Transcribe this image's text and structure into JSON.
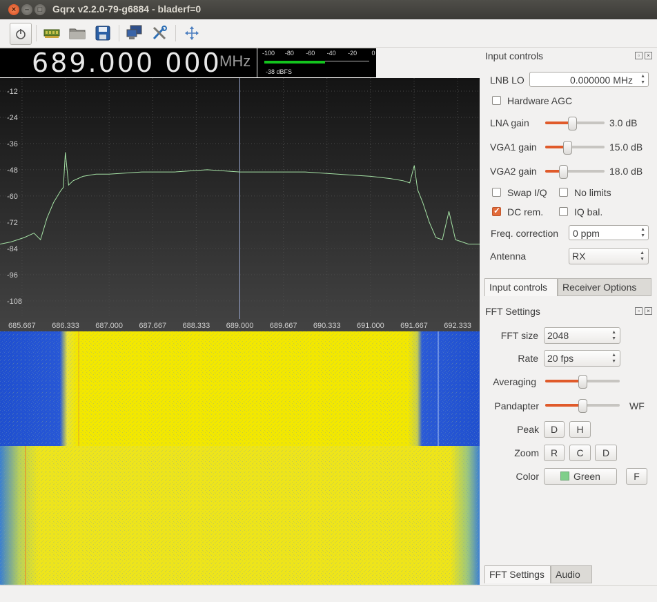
{
  "window": {
    "title": "Gqrx v2.2.0-79-g6884 - bladerf=0"
  },
  "toolbar": {
    "icons": [
      "power-icon",
      "hardware-icon",
      "folder-open-icon",
      "save-icon",
      "network-icon",
      "tools-icon",
      "fullscreen-icon"
    ]
  },
  "frequency": {
    "digits": "689.000 000",
    "unit": "MHz"
  },
  "meter": {
    "scale": [
      "-100",
      "-80",
      "-60",
      "-40",
      "-20",
      "0"
    ],
    "level_fraction": 0.58,
    "readout": "-38 dBFS"
  },
  "chart_data": {
    "type": "line",
    "title": "",
    "xlabel": "",
    "ylabel": "",
    "x_ticks": [
      "685.667",
      "686.333",
      "687.000",
      "687.667",
      "688.333",
      "689.000",
      "689.667",
      "690.333",
      "691.000",
      "691.667",
      "692.333"
    ],
    "y_ticks": [
      "-12",
      "-24",
      "-36",
      "-48",
      "-60",
      "-72",
      "-84",
      "-96",
      "-108"
    ],
    "xlim": [
      685.33,
      692.67
    ],
    "ylim": [
      -115,
      -6
    ],
    "center_marker": 689.0,
    "series": [
      {
        "color": "#a6e3a6",
        "x": [
          685.33,
          685.5,
          685.7,
          685.85,
          685.95,
          686.05,
          686.15,
          686.25,
          686.3,
          686.33,
          686.38,
          686.45,
          686.6,
          686.8,
          687.0,
          687.5,
          688.0,
          688.5,
          689.0,
          689.5,
          690.0,
          690.5,
          691.0,
          691.3,
          691.5,
          691.6,
          691.67,
          691.72,
          691.8,
          691.9,
          692.0,
          692.1,
          692.2,
          692.3,
          692.4,
          692.5,
          692.67
        ],
        "y": [
          -82,
          -81,
          -79,
          -77,
          -80,
          -70,
          -63,
          -58,
          -56,
          -40,
          -55,
          -53,
          -51,
          -50,
          -50,
          -49,
          -49,
          -48,
          -49,
          -49,
          -49,
          -50,
          -51,
          -52,
          -53,
          -54,
          -46,
          -57,
          -63,
          -72,
          -79,
          -80,
          -67,
          -80,
          -81,
          -82,
          -82
        ]
      }
    ]
  },
  "input_controls": {
    "header": "Input controls",
    "lnb_lo_label": "LNB LO",
    "lnb_lo_value": "0.000000 MHz",
    "hw_agc_label": "Hardware AGC",
    "hw_agc_checked": false,
    "lna_label": "LNA gain",
    "lna_value": "3.0 dB",
    "lna_level": 0.45,
    "vga1_label": "VGA1 gain",
    "vga1_value": "15.0 dB",
    "vga1_level": 0.37,
    "vga2_label": "VGA2 gain",
    "vga2_value": "18.0 dB",
    "vga2_level": 0.3,
    "swap_iq_label": "Swap I/Q",
    "swap_iq_checked": false,
    "no_limits_label": "No limits",
    "no_limits_checked": false,
    "dc_rem_label": "DC rem.",
    "dc_rem_checked": true,
    "iq_bal_label": "IQ bal.",
    "iq_bal_checked": false,
    "freq_corr_label": "Freq. correction",
    "freq_corr_value": "0 ppm",
    "antenna_label": "Antenna",
    "antenna_value": "RX"
  },
  "top_tabs": [
    "Input controls",
    "Receiver Options"
  ],
  "fft_settings": {
    "header": "FFT Settings",
    "fft_size_label": "FFT size",
    "fft_size_value": "2048",
    "rate_label": "Rate",
    "rate_value": "20 fps",
    "averaging_label": "Averaging",
    "averaging_level": 0.5,
    "pandapter_label": "Pandapter",
    "pandapter_level": 0.5,
    "wf_label": "WF",
    "peak_label": "Peak",
    "peak_buttons": [
      "D",
      "H"
    ],
    "zoom_label": "Zoom",
    "zoom_buttons": [
      "R",
      "C",
      "D"
    ],
    "color_label": "Color",
    "color_value": "Green",
    "color_swatch": "#7fcf8a",
    "f_button": "F"
  },
  "bottom_tabs": [
    "FFT Settings",
    "Audio"
  ]
}
